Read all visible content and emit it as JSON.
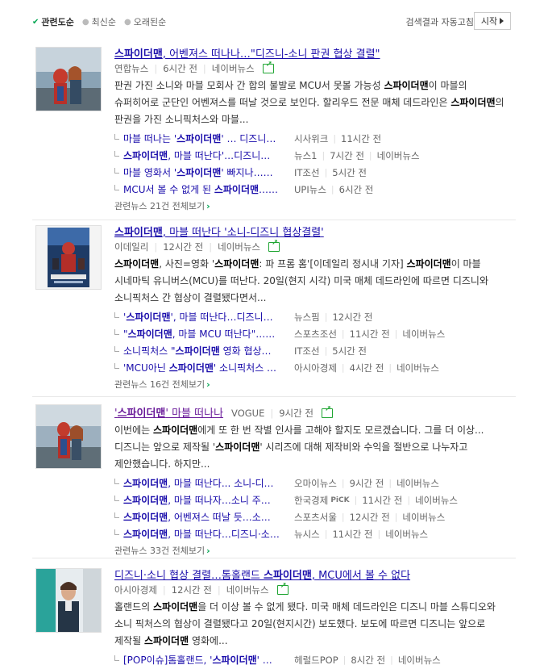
{
  "sort": {
    "options": [
      "관련도순",
      "최신순",
      "오래된순"
    ],
    "autorun_label": "검색결과 자동고침",
    "start_label": "시작"
  },
  "items": [
    {
      "title_pre": "",
      "title_kw": "스파이더맨",
      "title_post": ", 어벤져스 떠나나…\"디즈니-소니 판권 협상 결렬\"",
      "source": "연합뉴스",
      "time": "6시간 전",
      "naver": "네이버뉴스",
      "desc_parts": [
        "판권 가진 소니와 마블 모회사 간 합의 불발로 MCU서 못볼 가능성 ",
        "스파이더맨",
        "이 마블의 슈퍼히어로 군단인 어벤져스를 떠날 것으로 보인다. 할리우드 전문 매체 데드라인은 ",
        "스파이더맨",
        "의 판권을 가진 소니픽처스와 마블..."
      ],
      "related": [
        {
          "pre": "마블 떠나는 '",
          "kw": "스파이더맨",
          "post": "' … 디즈니…",
          "src": "시사위크",
          "time": "11시간 전",
          "naver": ""
        },
        {
          "pre": "",
          "kw": "스파이더맨",
          "post": ", 마블 떠난다'…디즈니…",
          "src": "뉴스1",
          "time": "7시간 전",
          "naver": "네이버뉴스"
        },
        {
          "pre": "마블 영화서 '",
          "kw": "스파이더맨",
          "post": "' 빠지나……",
          "src": "IT조선",
          "time": "5시간 전",
          "naver": ""
        },
        {
          "pre": "MCU서 볼 수 없게 된 ",
          "kw": "스파이더맨",
          "post": "……",
          "src": "UPI뉴스",
          "time": "6시간 전",
          "naver": ""
        }
      ],
      "more": "관련뉴스 21건 전체보기"
    },
    {
      "title_pre": "",
      "title_kw": "스파이더맨",
      "title_post": ", 마블 떠난다 '소니-디즈니 협상결렬'",
      "source": "이데일리",
      "time": "12시간 전",
      "naver": "네이버뉴스",
      "desc_parts": [
        "",
        "스파이더맨",
        ", 사진=영화 '",
        "스파이더맨",
        ": 파 프롬 홈'[이데일리 정시내 기자] ",
        "스파이더맨",
        "이 마블 시네마틱 유니버스(MCU)를 떠난다. 20일(현지 시각) 미국 매체 데드라인에 따르면 디즈니와 소니픽처스 간 협상이 결렬됐다면서..."
      ],
      "related": [
        {
          "pre": "'",
          "kw": "스파이더맨",
          "post": "', 마블 떠난다…디즈니…",
          "src": "뉴스핌",
          "time": "12시간 전",
          "naver": ""
        },
        {
          "pre": "\"",
          "kw": "스파이더맨",
          "post": ", 마블 MCU 떠난다\"……",
          "src": "스포츠조선",
          "time": "11시간 전",
          "naver": "네이버뉴스"
        },
        {
          "pre": "소니픽처스 \"",
          "kw": "스파이더맨",
          "post": " 영화 협상…",
          "src": "IT조선",
          "time": "5시간 전",
          "naver": ""
        },
        {
          "pre": "'MCU아닌 ",
          "kw": "스파이더맨",
          "post": "' 소니픽처스 …",
          "src": "아시아경제",
          "time": "4시간 전",
          "naver": "네이버뉴스"
        }
      ],
      "more": "관련뉴스 16건 전체보기"
    },
    {
      "title_pre": "'",
      "title_kw": "스파이더맨",
      "title_post": "' 마블 떠나나",
      "source": "VOGUE",
      "time": "9시간 전",
      "naver": "",
      "desc_parts": [
        "이번에는 ",
        "스파이더맨",
        "에게 또 한 번 작별 인사를 고해야 할지도 모르겠습니다. 그를 더 이상... 디즈니는 앞으로 제작될 '",
        "스파이더맨",
        "' 시리즈에 대해 제작비와 수익을 절반으로 나누자고 제안했습니다. 하지만..."
      ],
      "related": [
        {
          "pre": "",
          "kw": "스파이더맨",
          "post": ", 마블 떠난다... 소니-디…",
          "src": "오마이뉴스",
          "time": "9시간 전",
          "naver": "네이버뉴스",
          "pick": ""
        },
        {
          "pre": "",
          "kw": "스파이더맨",
          "post": ", 마블 떠나자…소니 주…",
          "src": "한국경제",
          "time": "11시간 전",
          "naver": "네이버뉴스",
          "pick": "PiCK"
        },
        {
          "pre": "",
          "kw": "스파이더맨",
          "post": ", 어벤져스 떠날 듯…소…",
          "src": "스포츠서울",
          "time": "12시간 전",
          "naver": "네이버뉴스",
          "pick": ""
        },
        {
          "pre": "",
          "kw": "스파이더맨",
          "post": ", 마블 떠난다…디즈니·소…",
          "src": "뉴시스",
          "time": "11시간 전",
          "naver": "네이버뉴스",
          "pick": ""
        }
      ],
      "more": "관련뉴스 33건 전체보기"
    },
    {
      "title_pre": "디즈니·소니 협상 결렬…톰홀랜드 ",
      "title_kw": "스파이더맨",
      "title_post": ", MCU에서 볼 수 없다",
      "source": "아시아경제",
      "time": "12시간 전",
      "naver": "네이버뉴스",
      "desc_parts": [
        "홀랜드의 ",
        "스파이더맨",
        "을 더 이상 볼 수 없게 됐다. 미국 매체 데드라인은 디즈니 마블 스튜디오와 소니 픽처스의 협상이 결렬됐다고 20일(현지시간) 보도했다. 보도에 따르면 디즈니는 앞으로 제작될 ",
        "스파이더맨",
        " 영화에..."
      ],
      "related": [
        {
          "pre": "[POP이슈]톰홀랜드, '",
          "kw": "스파이더맨",
          "post": "' …",
          "src": "헤럴드POP",
          "time": "8시간 전",
          "naver": "네이버뉴스"
        }
      ],
      "more": ""
    }
  ],
  "colors": {
    "link": "#1a0dab",
    "visited": "#6a1b9a",
    "accent": "#00a652"
  }
}
